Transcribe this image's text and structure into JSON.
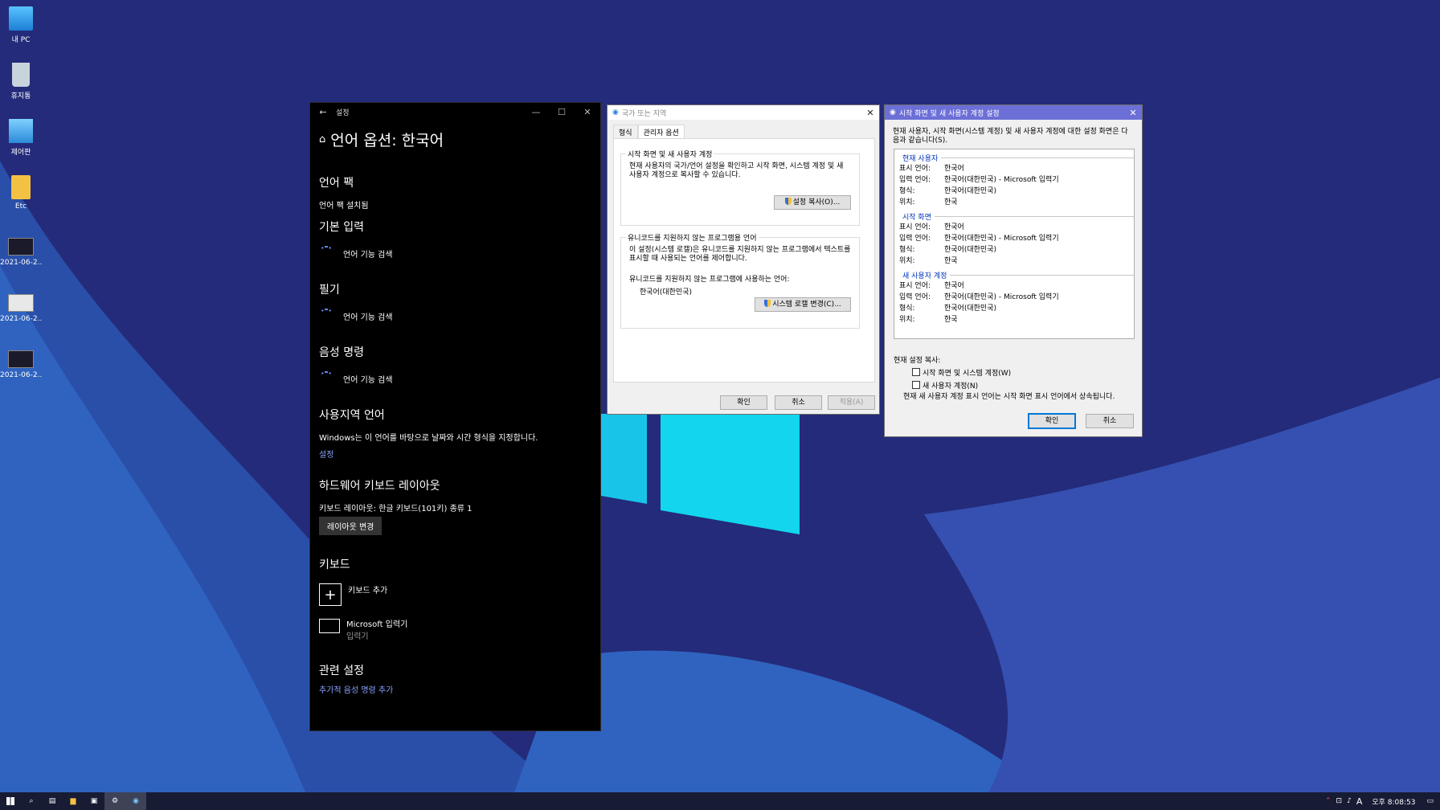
{
  "desktop": {
    "icons": [
      {
        "label": "내 PC",
        "icon": "monitor-icon"
      },
      {
        "label": "휴지통",
        "icon": "recycle-bin-icon"
      },
      {
        "label": "제어판",
        "icon": "control-panel-icon"
      },
      {
        "label": "Etc",
        "icon": "folder-icon"
      },
      {
        "label": "2021-06-2...",
        "icon": "screenshot-file-icon"
      },
      {
        "label": "2021-06-2...",
        "icon": "screenshot-file-icon"
      },
      {
        "label": "2021-06-2...",
        "icon": "screenshot-file-icon"
      }
    ]
  },
  "settings": {
    "window_title": "설정",
    "page_title": "언어 옵션: 한국어",
    "language_pack": {
      "heading": "언어 팩",
      "status": "언어 팩 설치됨"
    },
    "basic_input": {
      "heading": "기본 입력",
      "status": "언어 기능 검색"
    },
    "handwriting": {
      "heading": "필기",
      "status": "언어 기능 검색"
    },
    "speech": {
      "heading": "음성 명령",
      "status": "언어 기능 검색"
    },
    "regional": {
      "heading": "사용지역 언어",
      "description": "Windows는 이 언어를 바탕으로 날짜와 시간 형식을 지정합니다.",
      "link": "설정"
    },
    "hw_keyboard": {
      "heading": "하드웨어 키보드 레이아웃",
      "description": "키보드 레이아웃:  한글 키보드(101키) 종류 1",
      "button": "레이아웃 변경"
    },
    "keyboards": {
      "heading": "키보드",
      "add": "키보드 추가",
      "ime_name": "Microsoft 입력기",
      "ime_sub": "입력기"
    },
    "related": {
      "heading": "관련 설정",
      "link": "추가적 음성 명령 추가"
    }
  },
  "region": {
    "title": "국가 또는 지역",
    "tabs": [
      "형식",
      "관리자 옵션"
    ],
    "active_tab": "관리자 옵션",
    "welcome_group": {
      "label": "시작 화면 및 새 사용자 계정",
      "text": "현재 사용자의 국가/언어 설정을 확인하고 시작 화면, 시스템 계정 및 새 사용자 계정으로 복사할 수 있습니다.",
      "button": "설정 복사(O)..."
    },
    "nonunicode_group": {
      "label": "유니코드를 지원하지 않는 프로그램용 언어",
      "text": "이 설정(시스템 로캘)은 유니코드를 지원하지 않는 프로그램에서 텍스트를 표시할 때 사용되는 언어를 제어합니다.",
      "current_label": "유니코드를 지원하지 않는 프로그램에 사용하는 언어:",
      "current_value": "한국어(대한민국)",
      "button": "시스템 로캘 변경(C)..."
    },
    "buttons": {
      "ok": "확인",
      "cancel": "취소",
      "apply": "적용(A)"
    }
  },
  "welcome": {
    "title": "시작 화면 및 새 사용자 계정 설정",
    "intro": "현재 사용자, 시작 화면(시스템 계정) 및 새 사용자 계정에 대한 설정 화면은 다음과 같습니다(S).",
    "sections": [
      {
        "name": "현재 사용자",
        "rows": [
          {
            "k": "표시 언어:",
            "v": "한국어"
          },
          {
            "k": "입력 언어:",
            "v": "한국어(대한민국) - Microsoft 입력기"
          },
          {
            "k": "형식:",
            "v": "한국어(대한민국)"
          },
          {
            "k": "위치:",
            "v": "한국"
          }
        ]
      },
      {
        "name": "시작 화면",
        "rows": [
          {
            "k": "표시 언어:",
            "v": "한국어"
          },
          {
            "k": "입력 언어:",
            "v": "한국어(대한민국) - Microsoft 입력기"
          },
          {
            "k": "형식:",
            "v": "한국어(대한민국)"
          },
          {
            "k": "위치:",
            "v": "한국"
          }
        ]
      },
      {
        "name": "새 사용자 계정",
        "rows": [
          {
            "k": "표시 언어:",
            "v": "한국어"
          },
          {
            "k": "입력 언어:",
            "v": "한국어(대한민국) - Microsoft 입력기"
          },
          {
            "k": "형식:",
            "v": "한국어(대한민국)"
          },
          {
            "k": "위치:",
            "v": "한국"
          }
        ]
      }
    ],
    "copy_label": "현재 설정 복사:",
    "checkbox_system": "시작 화면 및 시스템 계정(W)",
    "checkbox_newuser": "새 사용자 계정(N)",
    "note": "현재 새 사용자 계정 표시 언어는 시작 화면 표시 언어에서 상속됩니다.",
    "buttons": {
      "ok": "확인",
      "cancel": "취소"
    }
  },
  "taskbar": {
    "ime_indicator": "A",
    "clock": "오후 8:08:53"
  }
}
